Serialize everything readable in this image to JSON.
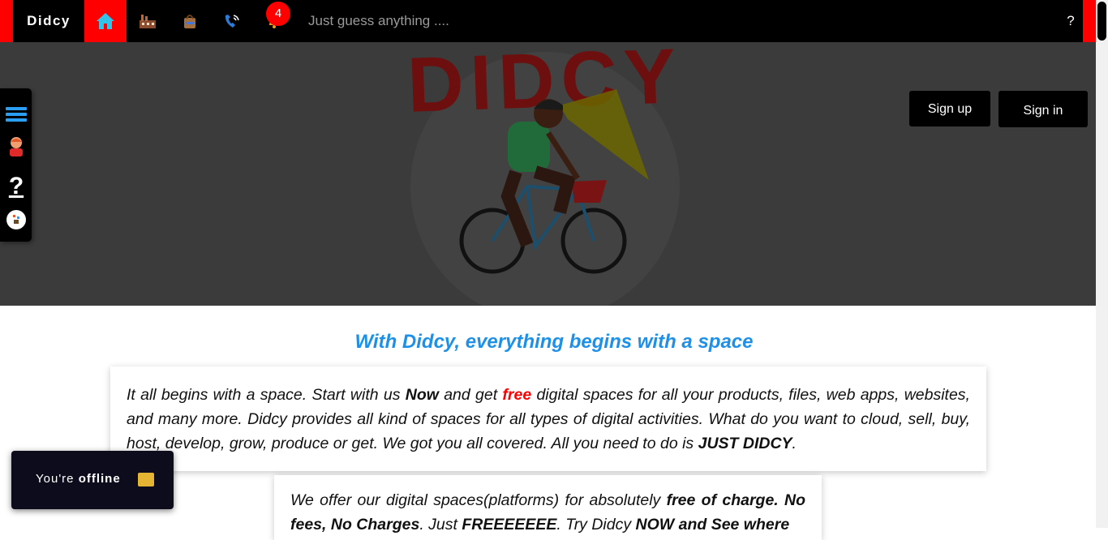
{
  "topbar": {
    "brand": "Didcy",
    "notification_count": "4",
    "search_placeholder": "Just guess anything ....",
    "help_label": "?",
    "nav_icons": [
      "home-icon",
      "factory-icon",
      "bag-icon",
      "phone-icon",
      "bell-icon"
    ]
  },
  "hero": {
    "logo_text": "DIDCY",
    "signup_label": "Sign up",
    "signin_label": "Sign in"
  },
  "dock": {
    "items": [
      "menu-icon",
      "profile-icon",
      "help-icon",
      "app-logo-icon"
    ],
    "help_label": "?"
  },
  "content": {
    "headline": "With Didcy, everything begins with a space",
    "card1": {
      "t1": "It all begins with a space. Start with us ",
      "b1": "Now",
      "t2": " and get ",
      "red": "free",
      "t3": " digital spaces for all your products, files, web apps, websites, and many more. Didcy provides all kind of spaces for all types of digital activities. What do you want to cloud, sell, buy, host, develop, grow, produce or get. We got you all covered. All you need to do is ",
      "b2": "JUST DIDCY",
      "t4": "."
    },
    "card2": {
      "t1": "We offer our digital spaces(platforms) for absolutely ",
      "b1": "free of charge. No fees, No Charges",
      "t2": ". Just ",
      "b2": "FREEEEEEE",
      "t3": ". Try Didcy ",
      "b3": "NOW and See where"
    }
  },
  "toast": {
    "prefix": "You're ",
    "bold": "offline"
  },
  "colors": {
    "accent_red": "#ff0000",
    "headline_blue": "#1e90e8",
    "topbar": "#000000",
    "hero_bg": "#3b3b3b"
  }
}
